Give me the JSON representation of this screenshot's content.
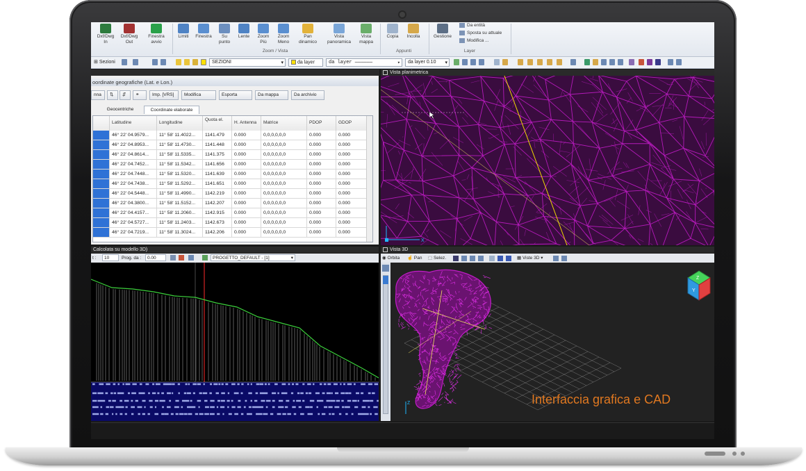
{
  "ribbon": {
    "buttons": [
      {
        "label": "Dxf/Dwg\nIn"
      },
      {
        "label": "Dxf/Dwg\nOut"
      },
      {
        "label": "Finestra\navvio"
      },
      {
        "label": "Limiti"
      },
      {
        "label": "Finestra"
      },
      {
        "label": "Su\npunto"
      },
      {
        "label": "Lente"
      },
      {
        "label": "Zoom\nPiù"
      },
      {
        "label": "Zoom\nMeno"
      },
      {
        "label": "Pan\ndinamico"
      },
      {
        "label": "Vista\npanoramica"
      },
      {
        "label": "Vista\nmappa"
      },
      {
        "label": "Copia"
      },
      {
        "label": "Incolla"
      },
      {
        "label": "Gestione"
      }
    ],
    "groups": {
      "zoom": "Zoom / Vista",
      "appunti": "Appunti",
      "layer": "Layer"
    },
    "layer_items": [
      "Da entità",
      "Sposta su attuale",
      "Modifica ..."
    ]
  },
  "toolbar2": {
    "sections_label": "Sezioni",
    "layer_name": "SEZIONI",
    "color_label": "da layer",
    "linetype_label": "da layer",
    "lineweight_label": "da layer 0.10"
  },
  "table_panel": {
    "title": "oordinate geografiche (Lat. e Lon.)",
    "buttons": [
      "nna",
      "Imp. [VRS]",
      "Modifica",
      "Esporta",
      "Da mappa",
      "Da archivio"
    ],
    "tabs": [
      "Geocentriche",
      "Coordinate elaborate"
    ],
    "columns": [
      "Latitudine",
      "Longitudine",
      "Quota el.",
      "H. Antenna",
      "Matrice",
      "PDOP",
      "GDOP"
    ],
    "rows": [
      [
        "46° 22' 04.9579...",
        "11° 58' 11.4022...",
        "1141.479",
        "0.000",
        "0,0,0,0,0,0",
        "0.000",
        "0.000"
      ],
      [
        "46° 22' 04.8953...",
        "11° 58' 11.4730...",
        "1141.448",
        "0.000",
        "0,0,0,0,0,0",
        "0.000",
        "0.000"
      ],
      [
        "46° 22' 04.8614...",
        "11° 58' 11.5335...",
        "1141.375",
        "0.000",
        "0,0,0,0,0,0",
        "0.000",
        "0.000"
      ],
      [
        "46° 22' 04.7452...",
        "11° 58' 11.5342...",
        "1141.656",
        "0.000",
        "0,0,0,0,0,0",
        "0.000",
        "0.000"
      ],
      [
        "46° 22' 04.7448...",
        "11° 58' 11.5320...",
        "1141.639",
        "0.000",
        "0,0,0,0,0,0",
        "0.000",
        "0.000"
      ],
      [
        "46° 22' 04.7438...",
        "11° 58' 11.5292...",
        "1141.651",
        "0.000",
        "0,0,0,0,0,0",
        "0.000",
        "0.000"
      ],
      [
        "46° 22' 04.5448...",
        "11° 58' 11.4990...",
        "1142.219",
        "0.000",
        "0,0,0,0,0,0",
        "0.000",
        "0.000"
      ],
      [
        "46° 22' 04.3800...",
        "11° 58' 11.5152...",
        "1142.207",
        "0.000",
        "0,0,0,0,0,0",
        "0.000",
        "0.000"
      ],
      [
        "46° 22' 04.4157...",
        "11° 58' 11.2060...",
        "1142.915",
        "0.000",
        "0,0,0,0,0,0",
        "0.000",
        "0.000"
      ],
      [
        "46° 22' 04.5727...",
        "11° 58' 11.2403...",
        "1142.673",
        "0.000",
        "0,0,0,0,0,0",
        "0.000",
        "0.000"
      ],
      [
        "46° 22' 04.7219...",
        "11° 58' 11.3024...",
        "1142.206",
        "0.000",
        "0,0,0,0,0,0",
        "0.000",
        "0.000"
      ]
    ]
  },
  "plan_view": {
    "title": "Vista planimetrica",
    "axis_x": "X"
  },
  "profile_panel": {
    "title": "Calcolata su modello 3D)",
    "step_label": "t :",
    "step_value": "10",
    "prog_label": "Prog. da :",
    "prog_value": "0.00",
    "project": "PROGETTO_DEFAULT - [1]"
  },
  "view3d": {
    "title": "Vista 3D",
    "buttons": [
      "Orbita",
      "Pan",
      "Selez.",
      "Viste 3D"
    ],
    "axis_z": "Z"
  },
  "caption": "Interfaccia grafica e CAD",
  "colors": {
    "mesh": "#c21cc8",
    "plan_bg": "#3a0c3f",
    "caption": "#e07820",
    "profile_line": "#3ccf3c",
    "selection": "#2f72d6"
  }
}
